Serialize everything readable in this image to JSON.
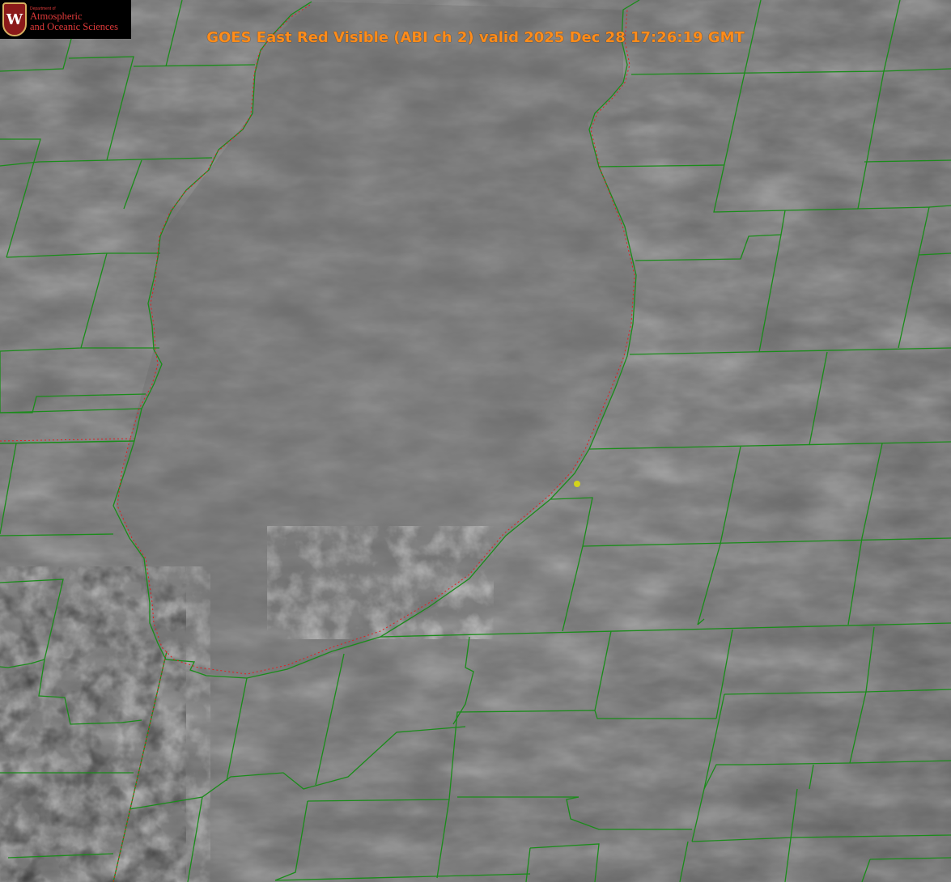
{
  "title": "GOES East Red Visible (ABI ch 2) valid 2025 Dec 28 17:26:19 GMT",
  "logo": {
    "department": "Department of",
    "line1": "Atmospheric",
    "line2": "and Oceanic Sciences",
    "seal_letter": "W"
  },
  "colors": {
    "county_lines": "#1a8c1a",
    "shoreline_dots": "#e02020",
    "title": "#ff8c1a",
    "marker": "#d4d41a",
    "logo_text": "#e03a3a"
  },
  "icons": [
    "university-seal-icon",
    "location-marker-icon"
  ]
}
